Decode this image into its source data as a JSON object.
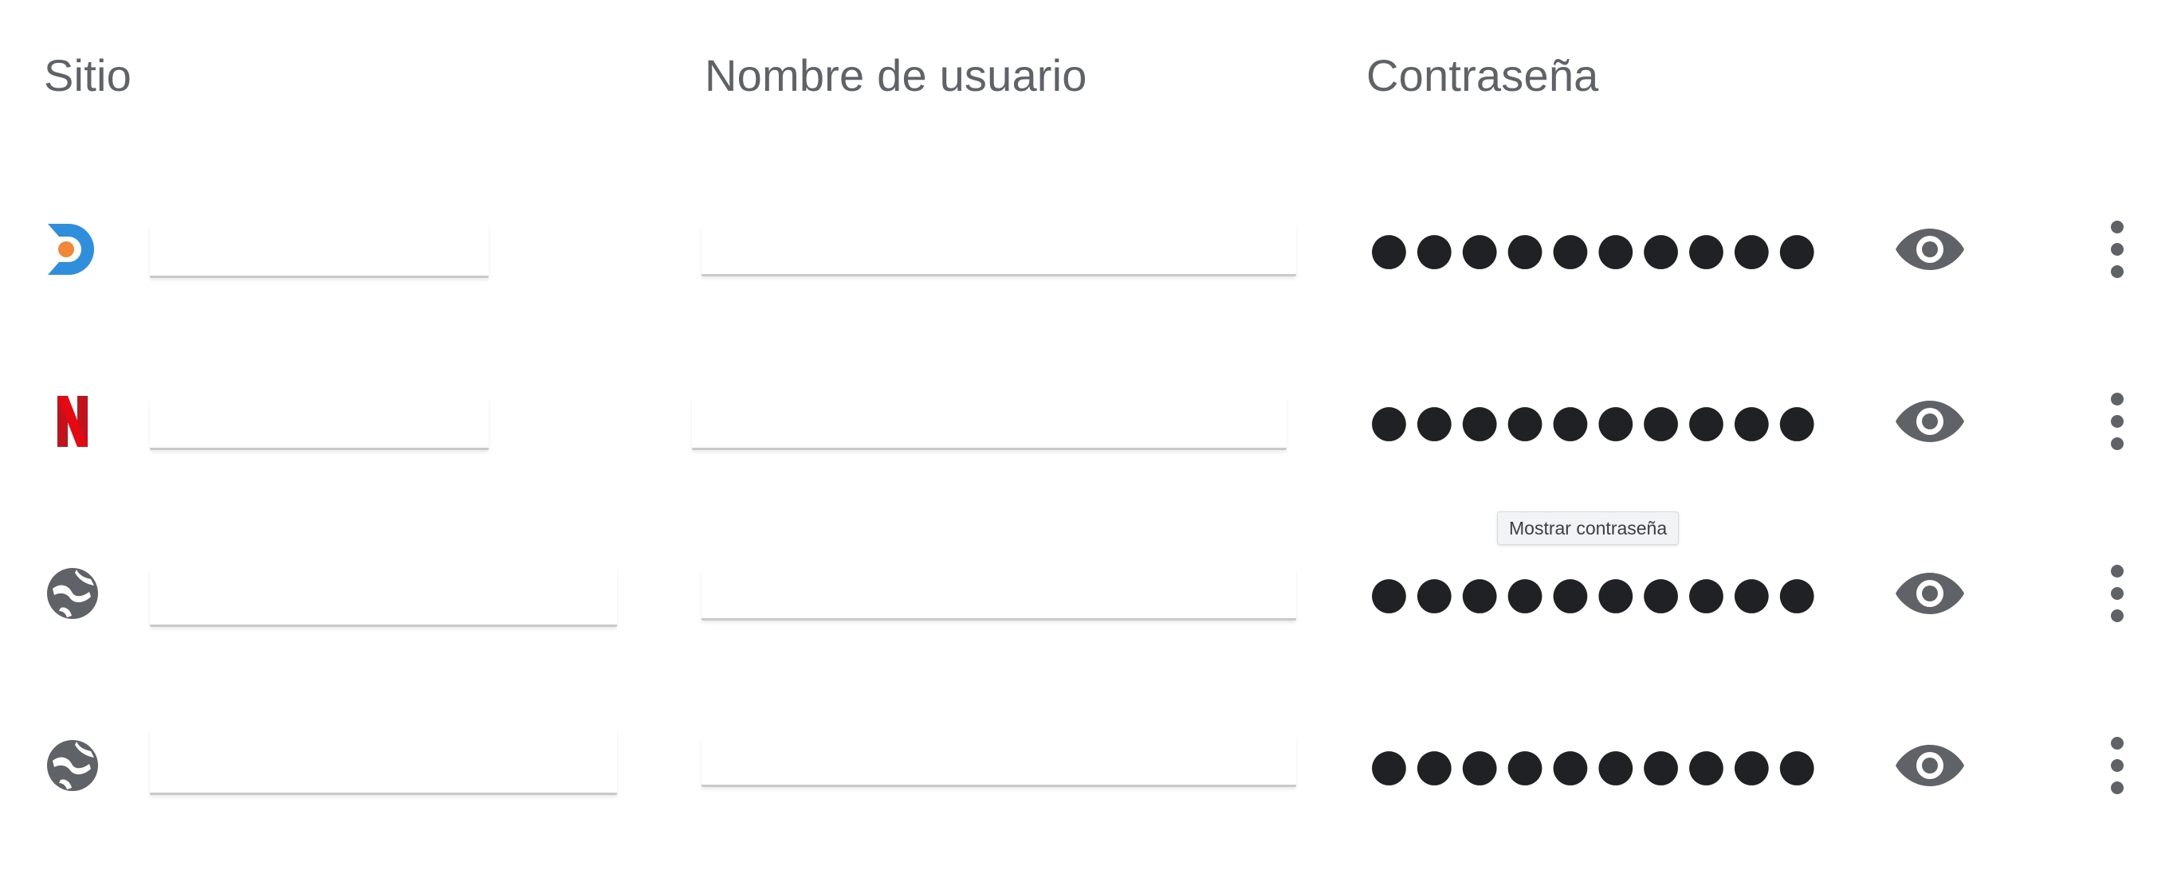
{
  "headers": {
    "site": "Sitio",
    "username": "Nombre de usuario",
    "password": "Contraseña"
  },
  "rows": [
    {
      "favicon": "blue-orange-d-logo-icon",
      "password_mask": "●●●●●●●●●●"
    },
    {
      "favicon": "netflix-n-logo-icon",
      "password_mask": "●●●●●●●●●●"
    },
    {
      "favicon": "globe-icon",
      "password_mask": "●●●●●●●●●●"
    },
    {
      "favicon": "globe-icon",
      "password_mask": "●●●●●●●●●●"
    }
  ],
  "tooltip": {
    "text": "Mostrar contraseña"
  },
  "icons": {
    "reveal": "eye-icon",
    "more": "more-vertical-icon"
  },
  "colors": {
    "text_header": "#5f6368",
    "icon_gray": "#5f6368",
    "dots": "#202124",
    "netflix_red": "#e50914",
    "brand_blue": "#2196f3",
    "brand_orange": "#f0883a"
  }
}
